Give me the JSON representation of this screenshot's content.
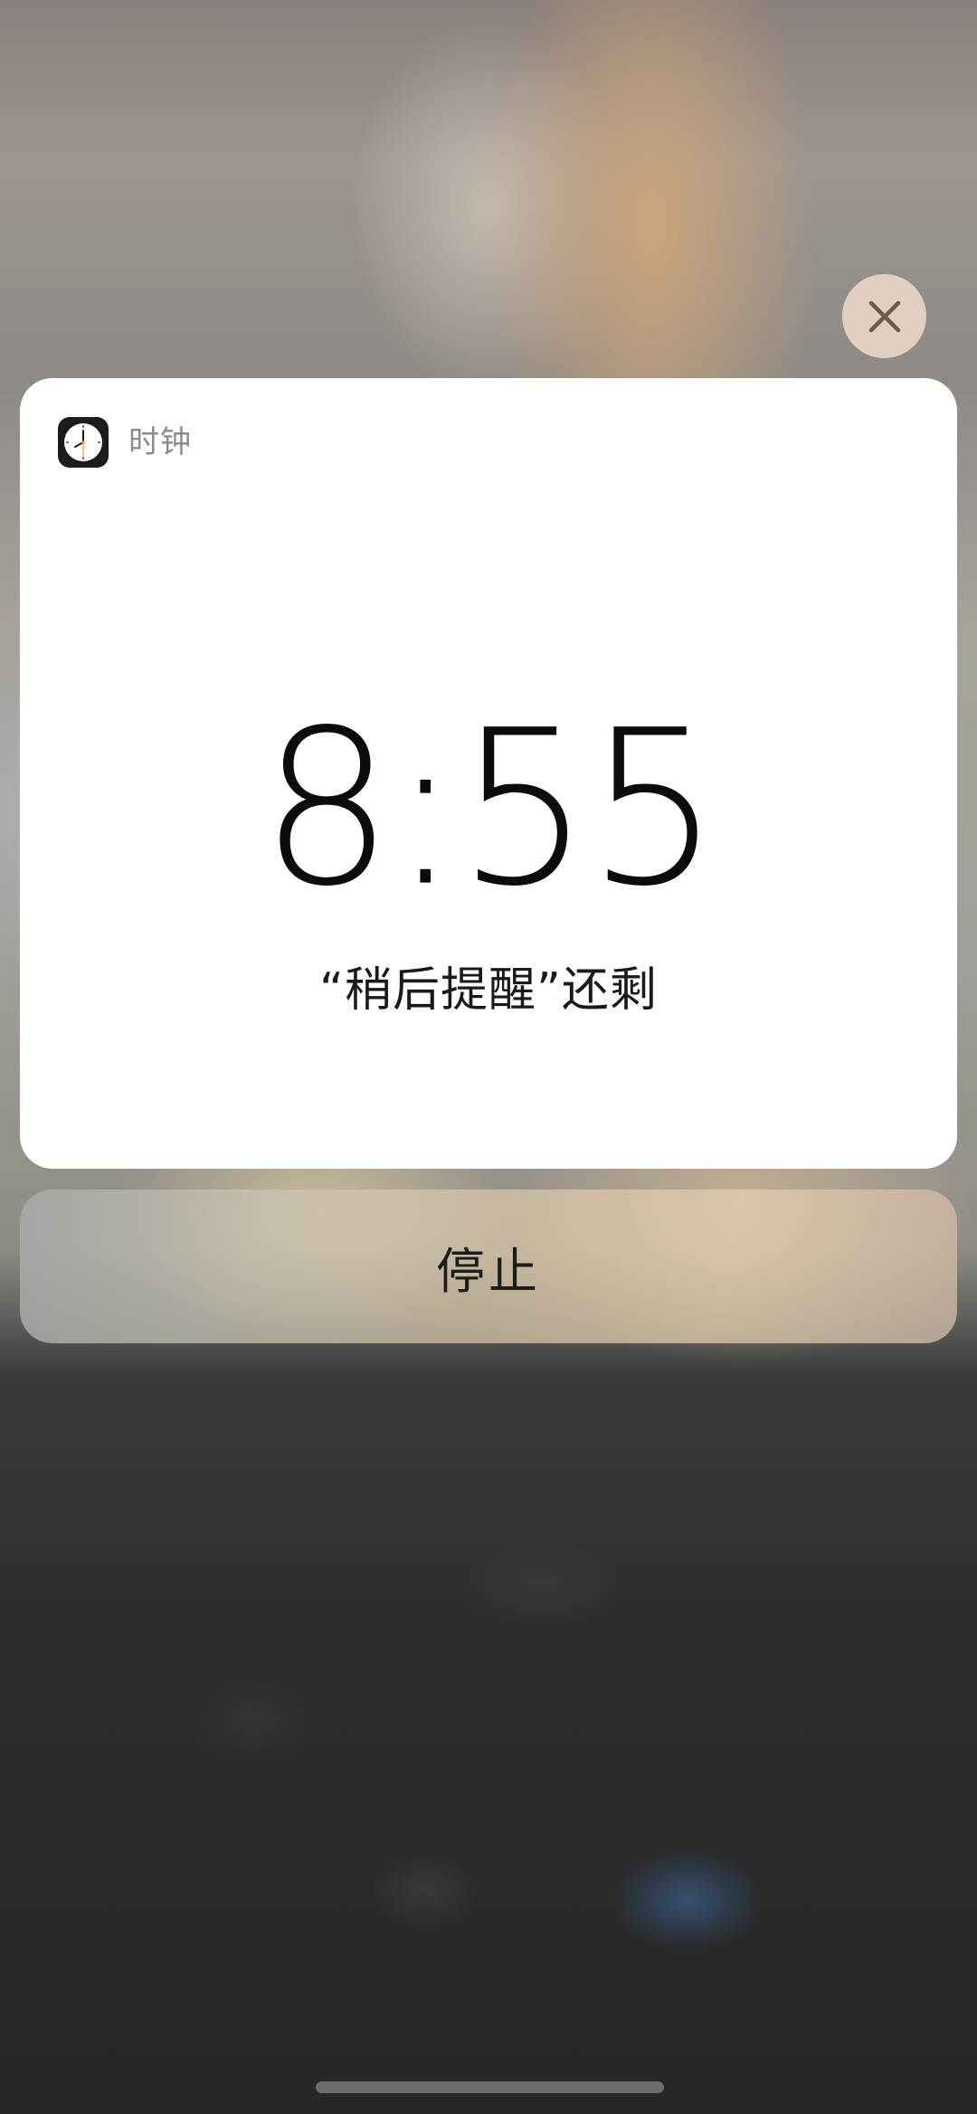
{
  "notification": {
    "app_name": "时钟",
    "app_icon": "clock-icon",
    "time": "8:55",
    "subtitle": "“稍后提醒”还剩"
  },
  "actions": {
    "stop_label": "停止",
    "close_icon": "close-icon"
  },
  "colors": {
    "card_background": "#ffffff",
    "app_name_color": "#8b8b8f",
    "time_color": "#0b0b0b"
  }
}
